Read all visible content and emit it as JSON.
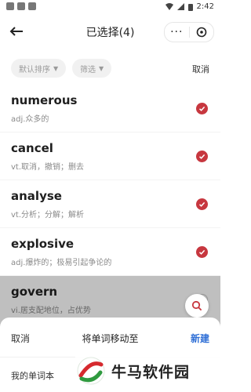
{
  "status_bar": {
    "time": "2:42"
  },
  "header": {
    "title": "已选择(4)",
    "more_label": "···"
  },
  "filters": {
    "sort_label": "默认排序",
    "filter_label": "筛选",
    "cancel_label": "取消"
  },
  "words": [
    {
      "word": "numerous",
      "definition": "adj.众多的",
      "selected": true
    },
    {
      "word": "cancel",
      "definition": "vt.取消，撤销；删去",
      "selected": true
    },
    {
      "word": "analyse",
      "definition": "vt.分析；分解；解析",
      "selected": true
    },
    {
      "word": "explosive",
      "definition": "adj.爆炸的；极易引起争论的",
      "selected": true
    },
    {
      "word": "govern",
      "definition": "vi.居支配地位，占优势",
      "selected": false
    }
  ],
  "sheet": {
    "cancel_label": "取消",
    "title": "将单词移动至",
    "new_label": "新建",
    "notebook_label": "我的单词本"
  },
  "watermark": {
    "text": "牛马软件园"
  },
  "colors": {
    "accent_red": "#c7373f",
    "link_blue": "#2f6fd6"
  }
}
